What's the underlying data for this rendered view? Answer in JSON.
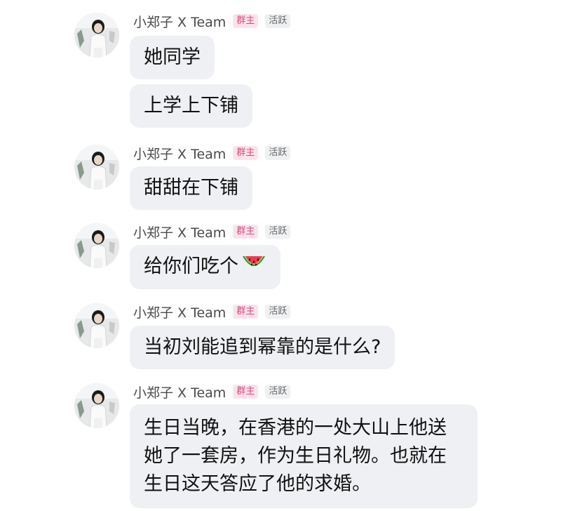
{
  "messages": [
    {
      "sender": "小郑子 X Team",
      "role_badge": "群主",
      "status_badge": "活跃",
      "bubbles": [
        "她同学",
        "上学上下铺"
      ]
    },
    {
      "sender": "小郑子 X Team",
      "role_badge": "群主",
      "status_badge": "活跃",
      "bubbles": [
        "甜甜在下铺"
      ]
    },
    {
      "sender": "小郑子 X Team",
      "role_badge": "群主",
      "status_badge": "活跃",
      "bubbles": [
        "给你们吃个"
      ],
      "emoji": "watermelon-icon"
    },
    {
      "sender": "小郑子 X Team",
      "role_badge": "群主",
      "status_badge": "活跃",
      "bubbles": [
        "当初刘能追到幂靠的是什么?"
      ]
    },
    {
      "sender": "小郑子 X Team",
      "role_badge": "群主",
      "status_badge": "活跃",
      "bubbles": [
        "生日当晚，在香港的一处大山上他送她了一套房，作为生日礼物。也就在生日这天答应了他的求婚。"
      ]
    }
  ],
  "colors": {
    "bubble_bg": "#eef0f3",
    "owner_badge_text": "#e0457a",
    "owner_badge_bg": "#fbe3ec",
    "active_badge_bg": "#eef0f2"
  }
}
